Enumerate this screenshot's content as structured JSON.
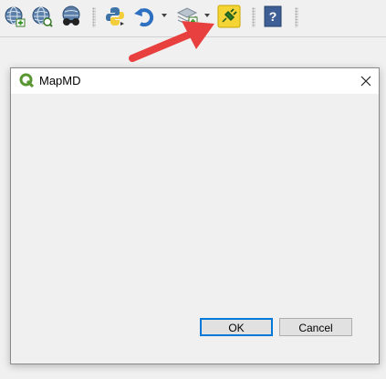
{
  "toolbar": {
    "icons": [
      "add-wms-layer-icon",
      "add-wcs-layer-icon",
      "add-wfs-layer-icon",
      "python-console-icon",
      "undo-icon",
      "database-layer-icon",
      "plugin-icon",
      "help-icon"
    ]
  },
  "dialog": {
    "title": "MapMD",
    "ok_label": "OK",
    "cancel_label": "Cancel",
    "close_glyph": "✕"
  },
  "colors": {
    "annotation_arrow": "#e8403f",
    "qgis_green": "#589632",
    "plugin_highlight": "#f5d435"
  }
}
